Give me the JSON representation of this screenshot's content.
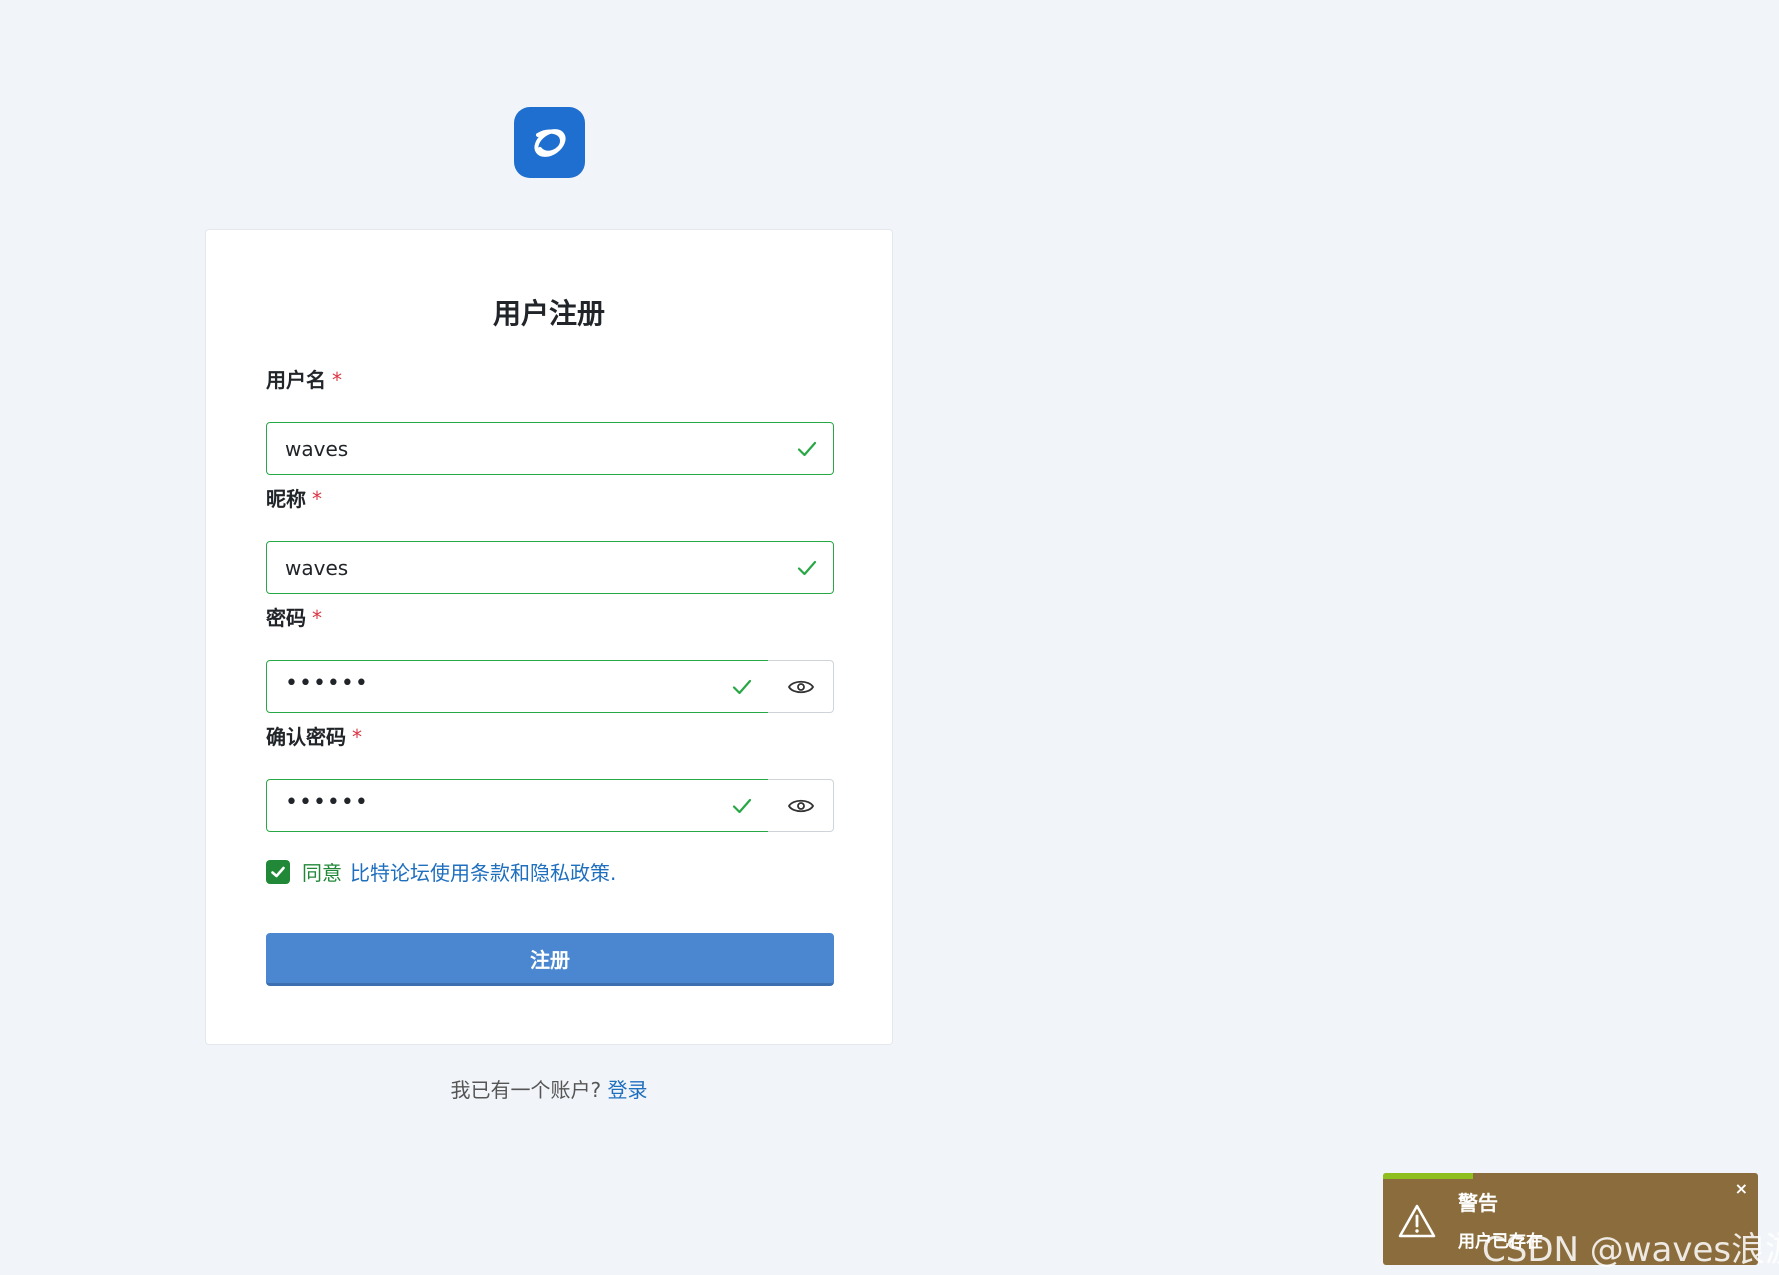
{
  "card": {
    "title": "用户注册"
  },
  "fields": {
    "username": {
      "label": "用户名",
      "required": "*",
      "value": "waves"
    },
    "nickname": {
      "label": "昵称",
      "required": "*",
      "value": "waves"
    },
    "password": {
      "label": "密码",
      "required": "*",
      "value": "••••••"
    },
    "confirm_password": {
      "label": "确认密码",
      "required": "*",
      "value": "••••••"
    }
  },
  "agree": {
    "prefix": "同意",
    "link": "比特论坛使用条款和隐私政策."
  },
  "submit_label": "注册",
  "login": {
    "text": "我已有一个账户?",
    "link": "登录"
  },
  "toast": {
    "title": "警告",
    "message": "用户已存在",
    "close": "×",
    "progress": 0.24
  },
  "watermark": "CSDN @waves浪游",
  "colors": {
    "brand": "#1f6fd0",
    "valid": "#28a745",
    "primary_button": "#4b87d1",
    "toast_bg": "#8b6d3d",
    "toast_progress": "#8fbf1f"
  },
  "icons": [
    "logo-icon",
    "check-icon",
    "eye-icon",
    "warning-icon",
    "close-icon"
  ]
}
